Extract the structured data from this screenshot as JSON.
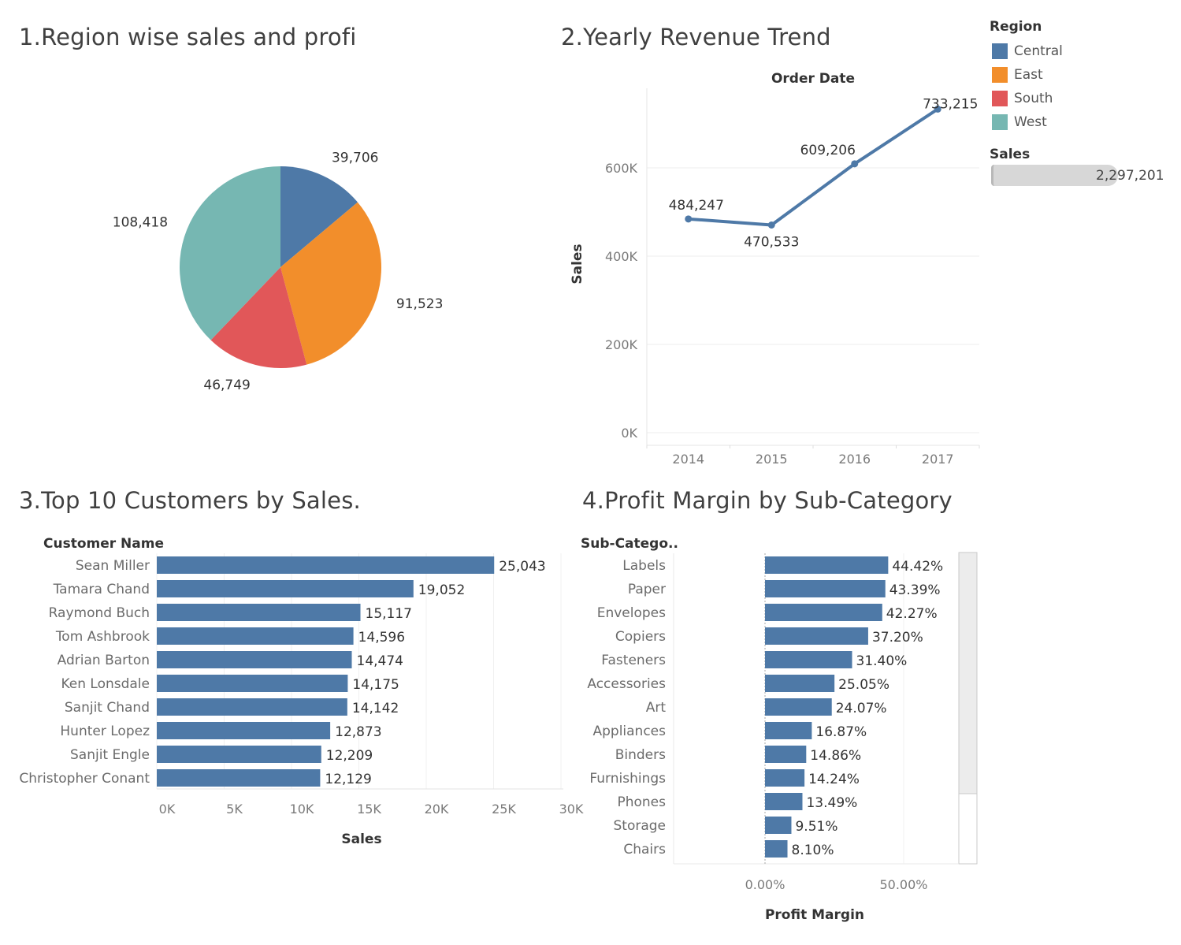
{
  "titles": {
    "t1": "1.Region wise sales and profi",
    "t2": "2.Yearly Revenue Trend",
    "t3": "3.Top 10 Customers by Sales.",
    "t4": "4.Profit Margin by Sub-Category"
  },
  "legend": {
    "header": "Region",
    "items": [
      {
        "label": "Central",
        "color": "#4e79a7"
      },
      {
        "label": "East",
        "color": "#f28e2b"
      },
      {
        "label": "South",
        "color": "#e15759"
      },
      {
        "label": "West",
        "color": "#76b7b2"
      }
    ],
    "sales_header": "Sales",
    "sales_total": "2,297,201"
  },
  "chart_data": [
    {
      "type": "pie",
      "title": "1.Region wise sales and profi",
      "slices": [
        {
          "region": "Central",
          "value": 39706,
          "label": "39,706",
          "color": "#4e79a7"
        },
        {
          "region": "East",
          "value": 91523,
          "label": "91,523",
          "color": "#f28e2b"
        },
        {
          "region": "South",
          "value": 46749,
          "label": "46,749",
          "color": "#e15759"
        },
        {
          "region": "West",
          "value": 108418,
          "label": "108,418",
          "color": "#76b7b2"
        }
      ]
    },
    {
      "type": "line",
      "title": "2.Yearly Revenue Trend",
      "header": "Order Date",
      "ylabel": "Sales",
      "x": [
        "2014",
        "2015",
        "2016",
        "2017"
      ],
      "y": [
        484247,
        470533,
        609206,
        733215
      ],
      "labels": [
        "484,247",
        "470,533",
        "609,206",
        "733,215"
      ],
      "ylim": [
        0,
        750000
      ],
      "yticks": [
        0,
        200000,
        400000,
        600000
      ],
      "ytick_labels": [
        "0K",
        "200K",
        "400K",
        "600K"
      ],
      "color": "#4e79a7"
    },
    {
      "type": "bar",
      "orientation": "horizontal",
      "title": "3.Top 10 Customers by Sales.",
      "row_header": "Customer Name",
      "xlabel": "Sales",
      "categories": [
        "Sean Miller",
        "Tamara Chand",
        "Raymond Buch",
        "Tom Ashbrook",
        "Adrian Barton",
        "Ken Lonsdale",
        "Sanjit Chand",
        "Hunter Lopez",
        "Sanjit Engle",
        "Christopher Conant"
      ],
      "values": [
        25043,
        19052,
        15117,
        14596,
        14474,
        14175,
        14142,
        12873,
        12209,
        12129
      ],
      "labels": [
        "25,043",
        "19,052",
        "15,117",
        "14,596",
        "14,474",
        "14,175",
        "14,142",
        "12,873",
        "12,209",
        "12,129"
      ],
      "xlim": [
        0,
        30000
      ],
      "xticks": [
        0,
        5000,
        10000,
        15000,
        20000,
        25000,
        30000
      ],
      "xtick_labels": [
        "0K",
        "5K",
        "10K",
        "15K",
        "20K",
        "25K",
        "30K"
      ],
      "color": "#4e79a7"
    },
    {
      "type": "bar",
      "orientation": "horizontal",
      "title": "4.Profit Margin by Sub-Category",
      "row_header": "Sub-Catego..",
      "xlabel": "Profit Margin",
      "categories": [
        "Labels",
        "Paper",
        "Envelopes",
        "Copiers",
        "Fasteners",
        "Accessories",
        "Art",
        "Appliances",
        "Binders",
        "Furnishings",
        "Phones",
        "Storage",
        "Chairs"
      ],
      "values": [
        44.42,
        43.39,
        42.27,
        37.2,
        31.4,
        25.05,
        24.07,
        16.87,
        14.86,
        14.24,
        13.49,
        9.51,
        8.1
      ],
      "labels": [
        "44.42%",
        "43.39%",
        "42.27%",
        "37.20%",
        "31.40%",
        "25.05%",
        "24.07%",
        "16.87%",
        "14.86%",
        "14.24%",
        "13.49%",
        "9.51%",
        "8.10%"
      ],
      "xticks": [
        0,
        50
      ],
      "xtick_labels": [
        "0.00%",
        "50.00%"
      ],
      "color": "#4e79a7"
    }
  ]
}
